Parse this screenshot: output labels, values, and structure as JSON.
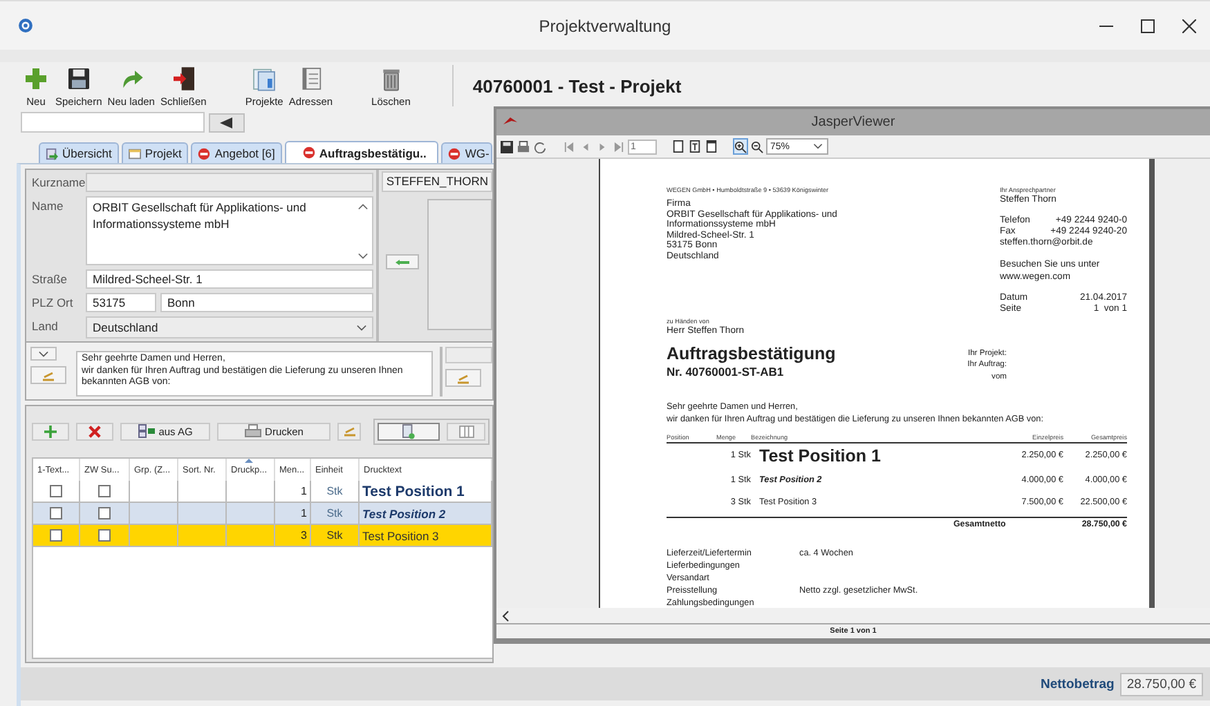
{
  "window": {
    "title": "Projektverwaltung"
  },
  "toolbar_groups": [
    {
      "items": [
        {
          "kind": "new",
          "label": "Neu"
        },
        {
          "kind": "save",
          "label": "Speichern"
        },
        {
          "kind": "reload",
          "label": "Neu laden"
        },
        {
          "kind": "exit",
          "label": "Schließen"
        }
      ]
    },
    {
      "items": [
        {
          "kind": "projects",
          "label": "Projekte"
        },
        {
          "kind": "addresses",
          "label": "Adressen"
        }
      ]
    },
    {
      "items": [
        {
          "kind": "delete",
          "label": "Löschen"
        }
      ]
    }
  ],
  "heading": "40760001 - Test - Projekt",
  "tabs": [
    {
      "kind": "overview",
      "label": "Übersicht",
      "selected": false
    },
    {
      "kind": "project",
      "label": "Projekt",
      "selected": false
    },
    {
      "kind": "blocked",
      "label": "Angebot [6]",
      "selected": false
    },
    {
      "kind": "blocked",
      "label": "Auftragsbestätigu..",
      "selected": true
    },
    {
      "kind": "blocked",
      "label": "WG-",
      "selected": false
    }
  ],
  "address": {
    "short_name_label": "Kurzname",
    "name_label": "Name",
    "name_value": "ORBIT Gesellschaft für Applikations- und Informationssysteme mbH",
    "street_label": "Straße",
    "street_value": "Mildred-Scheel-Str. 1",
    "city_label": "PLZ Ort",
    "zip_value": "53175",
    "city_value": "Bonn",
    "country_label": "Land",
    "country_value": "Deutschland"
  },
  "contact": {
    "name": "STEFFEN_THORN"
  },
  "letter_text": "Sehr geehrte Damen und Herren,\nwir danken für Ihren Auftrag und bestätigen die Lieferung zu unseren Ihnen bekannten AGB von:",
  "position_toolbar": [
    {
      "kind": "add"
    },
    {
      "kind": "remove"
    },
    {
      "kind": "from",
      "label": "aus AG"
    },
    {
      "kind": "print",
      "label": "Drucken"
    },
    {
      "kind": "edit"
    }
  ],
  "table": {
    "columns": [
      {
        "label": "1-Text...",
        "sorted": false
      },
      {
        "label": "ZW Su...",
        "sorted": false
      },
      {
        "label": "Grp. (Z...",
        "sorted": false
      },
      {
        "label": "Sort. Nr.",
        "sorted": false
      },
      {
        "label": "Druckp...",
        "sorted": true
      },
      {
        "label": "Men...",
        "sorted": false
      },
      {
        "label": "Einheit",
        "sorted": false
      },
      {
        "label": "Drucktext",
        "sorted": false
      }
    ],
    "rows": [
      {
        "single_text": false,
        "subtotal": false,
        "quantity": "1",
        "unit": "Stk",
        "text": "Test Position 1",
        "kind": "large",
        "selected": false,
        "marked": false
      },
      {
        "single_text": false,
        "subtotal": false,
        "quantity": "1",
        "unit": "Stk",
        "text": "Test Position 2",
        "kind": "emphasis",
        "selected": true,
        "marked": false
      },
      {
        "single_text": false,
        "subtotal": false,
        "quantity": "3",
        "unit": "Stk",
        "text": "Test Position 3",
        "kind": "plain",
        "selected": false,
        "marked": true
      }
    ]
  },
  "net": {
    "label": "Nettobetrag",
    "value": "28.750,00 €"
  },
  "viewer": {
    "title": "JasperViewer",
    "page": "1",
    "zoom": "75%",
    "status": "Seite 1 von 1",
    "document": {
      "sender": "WEGEN GmbH • Humboldtstraße 9 • 53639 Königswinter",
      "recipient": [
        "Firma",
        "ORBIT Gesellschaft für Applikations- und",
        "Informationssysteme mbH",
        "Mildred-Scheel-Str. 1",
        "53175 Bonn",
        "Deutschland"
      ],
      "contact_label": "Ihr Ansprechpartner",
      "contact_name": "Steffen Thorn",
      "phones": [
        {
          "label": "Telefon",
          "value": "+49 2244 9240-0"
        },
        {
          "label": "Fax",
          "value": "+49 2244 9240-20"
        }
      ],
      "email": "steffen.thorn@orbit.de",
      "visit": [
        "Besuchen Sie uns unter",
        "www.wegen.com"
      ],
      "dates": [
        {
          "label": "Datum",
          "value": "21.04.2017"
        },
        {
          "label": "Seite",
          "value": "1  von 1"
        }
      ],
      "attention_label": "zu Händen von",
      "attention_name": "Herr Steffen Thorn",
      "title": "Auftragsbestätigung",
      "number": "Nr. 40760001-ST-AB1",
      "references": [
        "Ihr Projekt:",
        "Ihr Auftrag:",
        "vom"
      ],
      "intro": [
        "Sehr geehrte Damen und Herren,",
        "wir danken für Ihren Auftrag und bestätigen die Lieferung zu unseren Ihnen bekannten AGB von:"
      ],
      "columns": [
        "Position",
        "Menge",
        "Bezeichnung",
        "Einzelpreis",
        "Gesamtpreis"
      ],
      "items": [
        {
          "quantity": "1 Stk",
          "text": "Test Position 1",
          "kind": "large",
          "unit_price": "2.250,00 €",
          "total": "2.250,00 €"
        },
        {
          "quantity": "1 Stk",
          "text": "Test Position 2",
          "kind": "emphasis",
          "unit_price": "4.000,00 €",
          "total": "4.000,00 €"
        },
        {
          "quantity": "3 Stk",
          "text": "Test Position 3",
          "kind": "plain",
          "unit_price": "7.500,00 €",
          "total": "22.500,00 €"
        }
      ],
      "total_label": "Gesamtnetto",
      "total": "28.750,00 €",
      "terms": [
        {
          "label": "Lieferzeit/Liefertermin",
          "value": "ca. 4 Wochen"
        },
        {
          "label": "Lieferbedingungen"
        },
        {
          "label": "Versandart"
        },
        {
          "label": "Preisstellung",
          "value": "Netto zzgl. gesetzlicher MwSt."
        },
        {
          "label": "Zahlungsbedingungen"
        }
      ]
    }
  }
}
